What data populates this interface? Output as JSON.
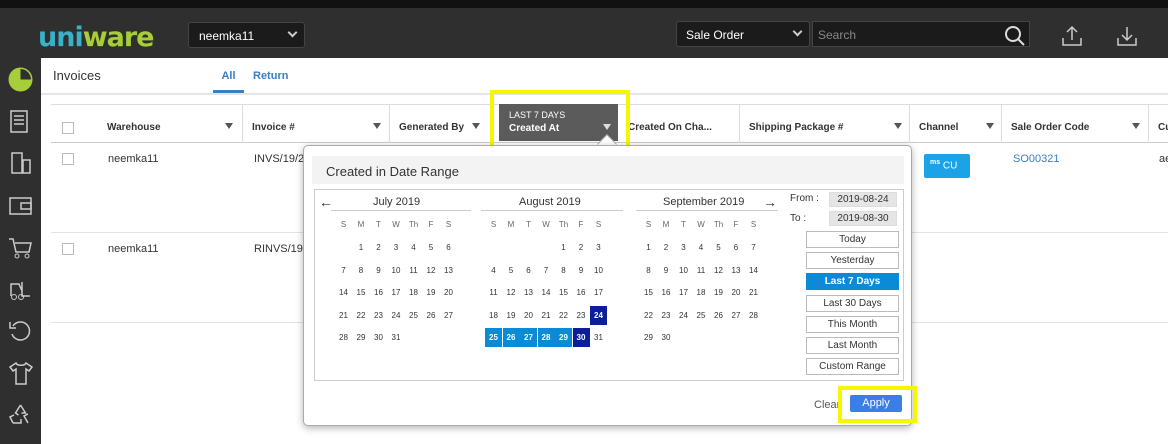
{
  "header": {
    "logo_text_a": "uni",
    "logo_text_b": "ware",
    "facility": "neemka11",
    "search_scope": "Sale Order",
    "search_placeholder": "Search"
  },
  "page": {
    "title": "Invoices",
    "tabs": [
      "All",
      "Return"
    ]
  },
  "table": {
    "columns": [
      "Warehouse",
      "Invoice #",
      "Generated By",
      "Created On Cha...",
      "Shipping Package #",
      "Channel",
      "Sale Order Code",
      "Cu"
    ],
    "rows": [
      {
        "warehouse": "neemka11",
        "invoice": "INVS/19/2",
        "sale_order": "SO00321",
        "cu": "ae"
      },
      {
        "warehouse": "neemka11",
        "invoice": "RINVS/19/"
      }
    ],
    "channel_badge": {
      "top": "ms",
      "main": "CU"
    }
  },
  "created_filter": {
    "label": "LAST 7 DAYS",
    "title": "Created At"
  },
  "date_popup": {
    "title": "Created in Date Range",
    "weekdays": [
      "S",
      "M",
      "T",
      "W",
      "Th",
      "F",
      "S"
    ],
    "months": [
      {
        "name": "July 2019",
        "first_dow": 1,
        "days": 31,
        "prev": "←"
      },
      {
        "name": "August 2019",
        "first_dow": 4,
        "days": 31
      },
      {
        "name": "September 2019",
        "first_dow": 0,
        "days": 30,
        "next": "→"
      }
    ],
    "selected_month_index": 1,
    "range_start_day": 24,
    "range_end_day": 30,
    "from_label": "From :",
    "from_value": "2019-08-24",
    "to_label": "To :",
    "to_value": "2019-08-30",
    "ranges": [
      "Today",
      "Yesterday",
      "Last 7 Days",
      "Last 30 Days",
      "This Month",
      "Last Month",
      "Custom Range"
    ],
    "active_range": "Last 7 Days",
    "clear_label": "Clear",
    "apply_label": "Apply"
  },
  "colors": {
    "accent": "#0b8bd5",
    "range_edge": "#0b1f9a",
    "highlight": "#f6f600",
    "apply": "#3a7ee8",
    "topbar": "#2f2f2f"
  }
}
